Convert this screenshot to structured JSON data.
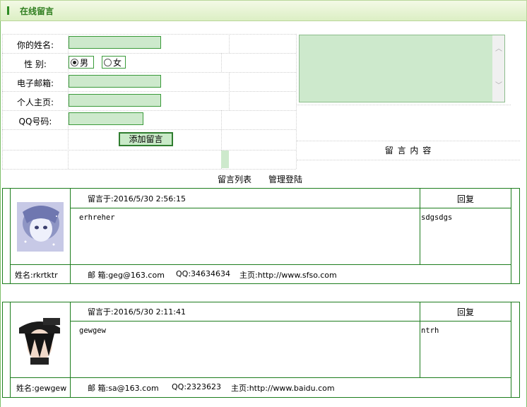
{
  "header": {
    "title": "在线留言"
  },
  "form": {
    "name_label": "你的姓名:",
    "gender_label": "性  别:",
    "gender_male": "男",
    "gender_female": "女",
    "email_label": "电子邮箱:",
    "homepage_label": "个人主页:",
    "qq_label": "QQ号码:",
    "submit_label": "添加留言",
    "content_label": "留 言 内 容"
  },
  "nav": {
    "list_link": "留言列表",
    "admin_link": "管理登陆"
  },
  "messages": [
    {
      "time": "留言于:2016/5/30 2:56:15",
      "reply_label": "回复",
      "body": "erhreher",
      "reply": "sdgsdgs",
      "name": "姓名:rkrtktr",
      "email": "邮 箱:geg@163.com",
      "qq": "QQ:34634634",
      "homepage": "主页:http://www.sfso.com"
    },
    {
      "time": "留言于:2016/5/30 2:11:41",
      "reply_label": "回复",
      "body": "gewgew",
      "reply": "ntrh",
      "name": "姓名:gewgew",
      "email": "邮 箱:sa@163.com",
      "qq": "QQ:2323623",
      "homepage": "主页:http://www.baidu.com"
    }
  ],
  "colors": {
    "accent": "#2e7d1e",
    "input_bg": "#cde9cc",
    "border": "#1d7d1d"
  }
}
